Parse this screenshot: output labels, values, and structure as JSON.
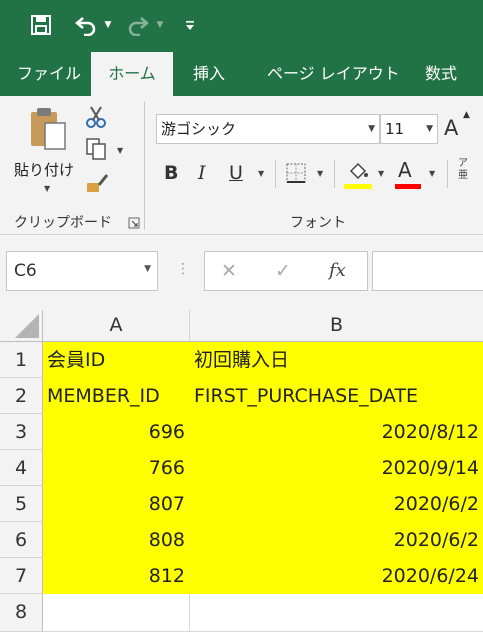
{
  "quick_access": {
    "icons": [
      "save-icon",
      "undo-icon",
      "redo-icon",
      "customize-icon"
    ]
  },
  "tabs": [
    {
      "label": "ファイル",
      "active": false
    },
    {
      "label": "ホーム",
      "active": true
    },
    {
      "label": "挿入",
      "active": false
    },
    {
      "label": "ページ レイアウト",
      "active": false
    },
    {
      "label": "数式",
      "active": false
    }
  ],
  "ribbon": {
    "clipboard": {
      "paste_label": "貼り付け",
      "group_label": "クリップボード"
    },
    "font": {
      "font_name": "游ゴシック",
      "font_size": "11",
      "bold": "B",
      "italic": "I",
      "underline": "U",
      "grow_font": "A",
      "group_label": "フォント",
      "fill_color": "#ffff00",
      "font_color": "#ff0000"
    },
    "phonetic_glyph": "ア亜"
  },
  "formula_bar": {
    "name_box": "C6",
    "cancel": "✕",
    "enter": "✓",
    "fx": "fx",
    "formula": ""
  },
  "sheet": {
    "columns": [
      "A",
      "B"
    ],
    "rows": [
      {
        "num": "1",
        "a": "会員ID",
        "b": "初回購入日"
      },
      {
        "num": "2",
        "a": "MEMBER_ID",
        "b": "FIRST_PURCHASE_DATE"
      },
      {
        "num": "3",
        "a": "696",
        "b": "2020/8/12"
      },
      {
        "num": "4",
        "a": "766",
        "b": "2020/9/14"
      },
      {
        "num": "5",
        "a": "807",
        "b": "2020/6/2"
      },
      {
        "num": "6",
        "a": "808",
        "b": "2020/6/2"
      },
      {
        "num": "7",
        "a": "812",
        "b": "2020/6/24"
      },
      {
        "num": "8",
        "a": "",
        "b": ""
      }
    ],
    "highlight_color": "#ffff00"
  }
}
